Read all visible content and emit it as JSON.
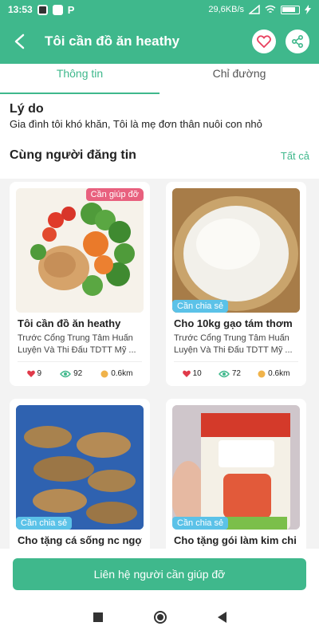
{
  "status_bar": {
    "time": "13:53",
    "speed": "29,6KB/s"
  },
  "appbar": {
    "title": "Tôi cần đồ ăn heathy"
  },
  "tabs": [
    {
      "label": "Thông tin",
      "active": true
    },
    {
      "label": "Chỉ đường",
      "active": false
    }
  ],
  "reason": {
    "heading": "Lý do",
    "text": "Gia đình tôi khó khăn, Tôi là mẹ đơn thân nuôi con nhỏ"
  },
  "section": {
    "title": "Cùng người đăng tin",
    "see_all": "Tất cả"
  },
  "cards": [
    {
      "badge": "Cần giúp đỡ",
      "title": "Tôi cần đồ ăn heathy",
      "address": "Trước Cổng Trung Tâm Huấn Luyện Và Thi Đấu TDTT Mỹ ...",
      "likes": "9",
      "views": "92",
      "distance": "0.6km"
    },
    {
      "badge": "Cần chia sẻ",
      "title": "Cho 10kg gạo tám thơm",
      "address": "Trước Cổng Trung Tâm Huấn Luyện Và Thi Đấu TDTT Mỹ ...",
      "likes": "10",
      "views": "72",
      "distance": "0.6km"
    },
    {
      "badge": "Cần chia sẻ",
      "title": "Cho tặng cá sống nc ngọt"
    },
    {
      "badge": "Cần chia sẻ",
      "title": "Cho tặng gói làm kim chi"
    }
  ],
  "contact_button": "Liên hệ người cần giúp đỡ",
  "colors": {
    "primary": "#3fb88c",
    "badge_help": "#e8607e",
    "badge_share": "#5bc2e8"
  }
}
